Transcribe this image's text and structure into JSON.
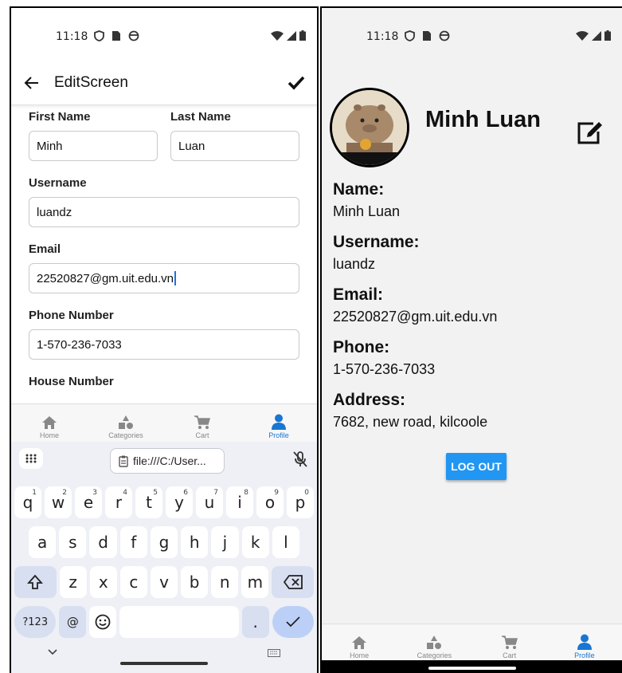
{
  "status": {
    "time": "11:18"
  },
  "edit_screen": {
    "title": "EditScreen",
    "fields": {
      "first_name": {
        "label": "First Name",
        "value": "Minh"
      },
      "last_name": {
        "label": "Last Name",
        "value": "Luan"
      },
      "username": {
        "label": "Username",
        "value": "luandz"
      },
      "email": {
        "label": "Email",
        "value": "22520827@gm.uit.edu.vn"
      },
      "phone": {
        "label": "Phone Number",
        "value": "1-570-236-7033"
      },
      "house": {
        "label": "House Number"
      }
    }
  },
  "nav": {
    "items": [
      {
        "label": "Home",
        "icon": "home-icon"
      },
      {
        "label": "Categories",
        "icon": "categories-icon"
      },
      {
        "label": "Cart",
        "icon": "cart-icon"
      },
      {
        "label": "Profile",
        "icon": "profile-icon"
      }
    ],
    "active": "Profile",
    "active_color": "#1976d2"
  },
  "keyboard": {
    "clipboard": "file:///C:/User...",
    "row1": [
      {
        "k": "q",
        "n": "1"
      },
      {
        "k": "w",
        "n": "2"
      },
      {
        "k": "e",
        "n": "3"
      },
      {
        "k": "r",
        "n": "4"
      },
      {
        "k": "t",
        "n": "5"
      },
      {
        "k": "y",
        "n": "6"
      },
      {
        "k": "u",
        "n": "7"
      },
      {
        "k": "i",
        "n": "8"
      },
      {
        "k": "o",
        "n": "9"
      },
      {
        "k": "p",
        "n": "0"
      }
    ],
    "row2": [
      "a",
      "s",
      "d",
      "f",
      "g",
      "h",
      "j",
      "k",
      "l"
    ],
    "row3": [
      "z",
      "x",
      "c",
      "v",
      "b",
      "n",
      "m"
    ],
    "sym": "?123",
    "at": "@",
    "period": "."
  },
  "profile": {
    "name": "Minh Luan",
    "labels": {
      "name": "Name:",
      "username": "Username:",
      "email": "Email:",
      "phone": "Phone:",
      "address": "Address:"
    },
    "values": {
      "name": "Minh Luan",
      "username": "luandz",
      "email": "22520827@gm.uit.edu.vn",
      "phone": "1-570-236-7033",
      "address": "7682, new road, kilcoole"
    },
    "logout_label": "LOG OUT",
    "button_color": "#2196f3"
  }
}
